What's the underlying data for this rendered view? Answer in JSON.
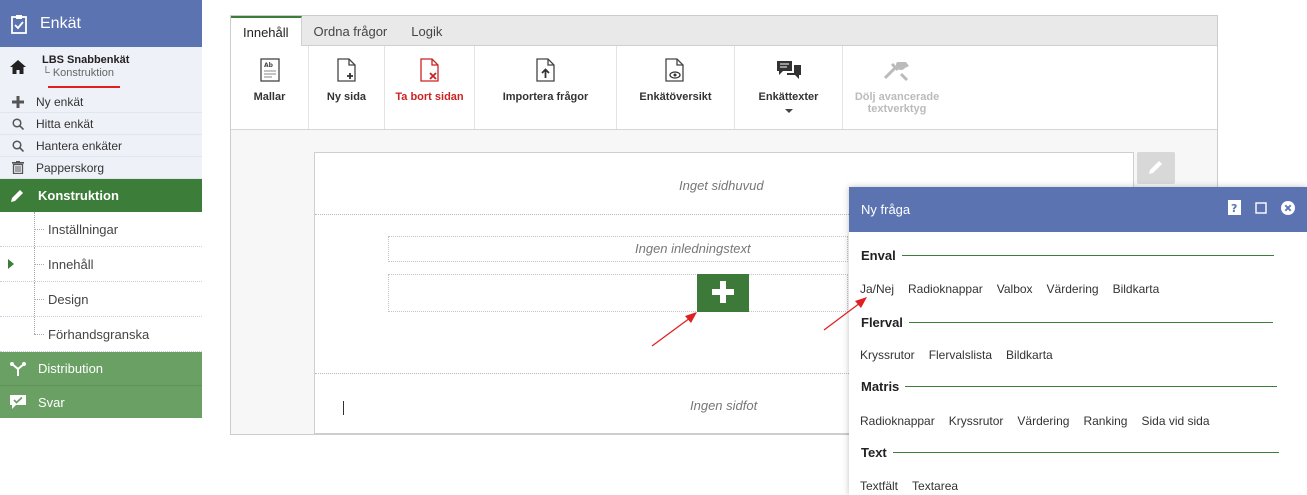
{
  "sidebar": {
    "header_title": "Enkät",
    "survey": {
      "name": "LBS Snabbenkät",
      "sub": "└ Konstruktion"
    },
    "menu": [
      {
        "label": "Ny enkät",
        "icon": "plus-icon"
      },
      {
        "label": "Hitta enkät",
        "icon": "search-icon"
      },
      {
        "label": "Hantera enkäter",
        "icon": "search-icon"
      },
      {
        "label": "Papperskorg",
        "icon": "trash-icon"
      }
    ],
    "section_construction": "Konstruktion",
    "construction_items": [
      "Inställningar",
      "Innehåll",
      "Design",
      "Förhandsgranska"
    ],
    "active_item": "Innehåll",
    "section_distribution": "Distribution",
    "section_answers": "Svar"
  },
  "tabs": [
    "Innehåll",
    "Ordna frågor",
    "Logik"
  ],
  "toolbar": {
    "templates": "Mallar",
    "new_page": "Ny sida",
    "delete_page": "Ta bort sidan",
    "import_questions": "Importera frågor",
    "survey_overview": "Enkätöversikt",
    "survey_texts": "Enkättexter",
    "hide_advanced_1": "Dölj avancerade",
    "hide_advanced_2": "textverktyg"
  },
  "page": {
    "no_header": "Inget sidhuvud",
    "no_intro": "Ingen inledningstext",
    "no_footer": "Ingen sidfot"
  },
  "dialog": {
    "title": "Ny fråga",
    "categories": [
      {
        "name": "Enval",
        "options": [
          "Ja/Nej",
          "Radioknappar",
          "Valbox",
          "Värdering",
          "Bildkarta"
        ]
      },
      {
        "name": "Flerval",
        "options": [
          "Kryssrutor",
          "Flervalslista",
          "Bildkarta"
        ]
      },
      {
        "name": "Matris",
        "options": [
          "Radioknappar",
          "Kryssrutor",
          "Värdering",
          "Ranking",
          "Sida vid sida"
        ]
      },
      {
        "name": "Text",
        "options": [
          "Textfält",
          "Textarea"
        ]
      }
    ]
  },
  "colors": {
    "header_blue": "#5b73b0",
    "green_dark": "#3c7d3a",
    "green_light": "#6aa064",
    "delete_red": "#cc2222",
    "annotation_red": "#e02020"
  }
}
